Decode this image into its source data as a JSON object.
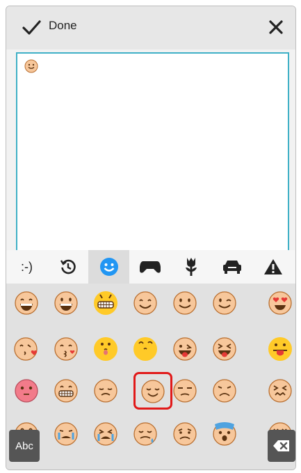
{
  "header": {
    "done_label": "Done"
  },
  "editor": {
    "content_emoji_name": "smiling-face-emoji"
  },
  "categories": [
    {
      "label": ":-)",
      "icon": "emoticon-text"
    },
    {
      "icon": "recent-clock-icon"
    },
    {
      "icon": "smiley-icon",
      "selected": true
    },
    {
      "icon": "gamepad-icon"
    },
    {
      "icon": "flower-icon"
    },
    {
      "icon": "car-icon"
    },
    {
      "icon": "triangle-icon"
    }
  ],
  "emoji_rows": [
    [
      "grinning-face",
      "beaming-face",
      "grimacing-face-yellow",
      "smiling-face",
      "slightly-smiling-face",
      "winking-face",
      "heart-eyes-face"
    ],
    [
      "face-blowing-kiss",
      "kissing-face-heart",
      "face-tongue-yellow",
      "winking-tongue-yellow",
      "winking-tongue-face",
      "squinting-tongue-face",
      "tongue-out-yellow"
    ],
    [
      "flushed-face",
      "grimacing-face",
      "pensive-face",
      "relieved-face",
      "unamused-face",
      "disappointed-face",
      "confounded-face"
    ],
    [
      "neutral-face",
      "crying-face",
      "weary-face",
      "sad-sweat-face",
      "worried-face",
      "fearful-face",
      "dizzy-face"
    ]
  ],
  "selected_emoji": "relieved-face",
  "keys": {
    "abc_label": "Abc"
  },
  "colors": {
    "accent": "#3fb0c6",
    "selection": "#e11919",
    "emoji_skin": "#f7c79b"
  }
}
